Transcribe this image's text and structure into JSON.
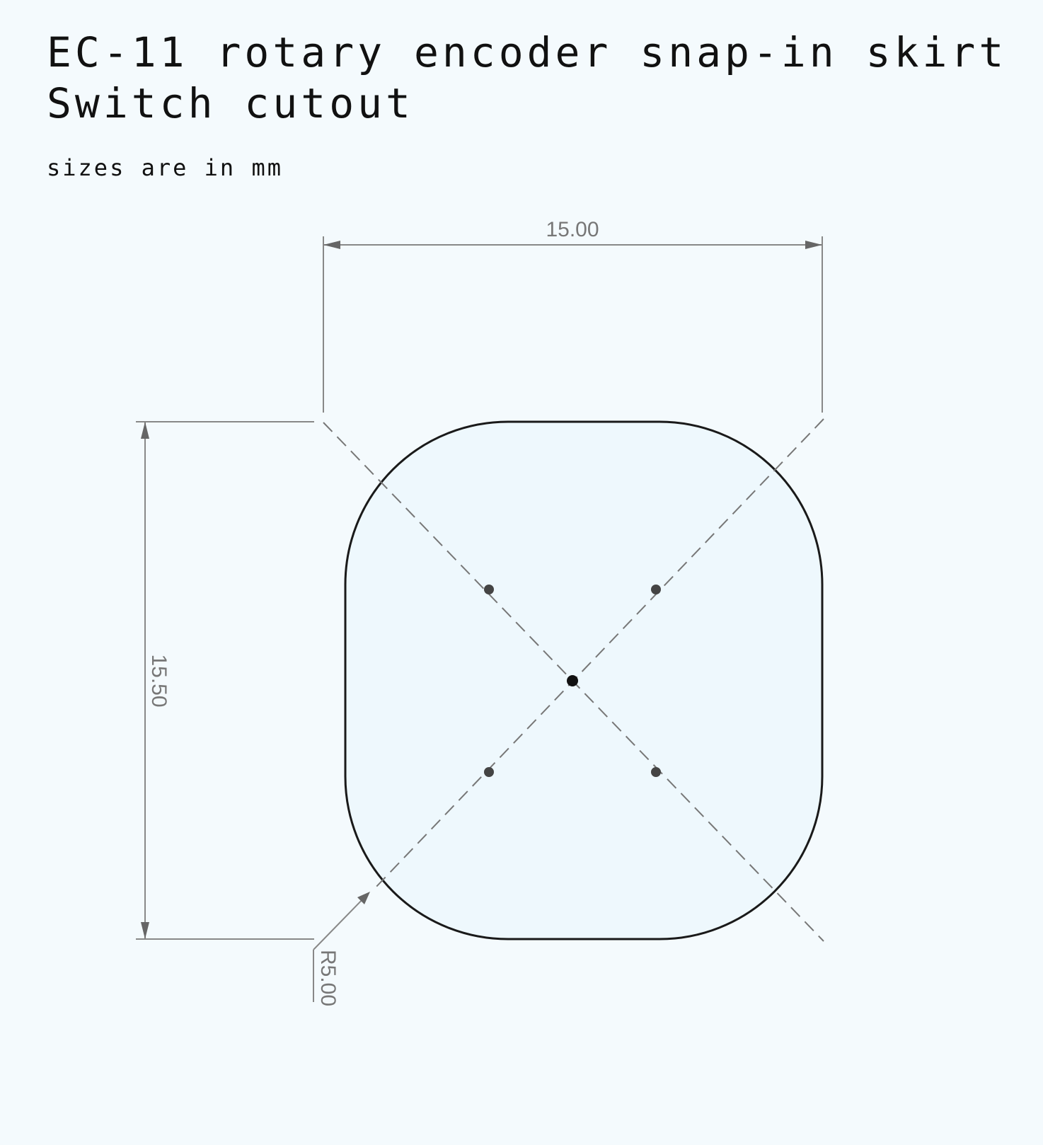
{
  "header": {
    "title_line1": "EC-11 rotary encoder snap-in skirt",
    "title_line2": "Switch cutout"
  },
  "note": "sizes are in mm",
  "drawing": {
    "units": "mm",
    "outline": {
      "shape": "rounded-rectangle",
      "width": 15.0,
      "height": 15.5,
      "corner_radius": 5.0
    },
    "dimensions": {
      "width_label": "15.00",
      "height_label": "15.50",
      "radius_label": "R5.00"
    },
    "colors": {
      "background": "#f4fafd",
      "fill": "#eef8fd",
      "outline": "#1a1a1a",
      "dimension_line": "#888888",
      "dimension_text": "#777777",
      "centerline": "#777777"
    }
  }
}
